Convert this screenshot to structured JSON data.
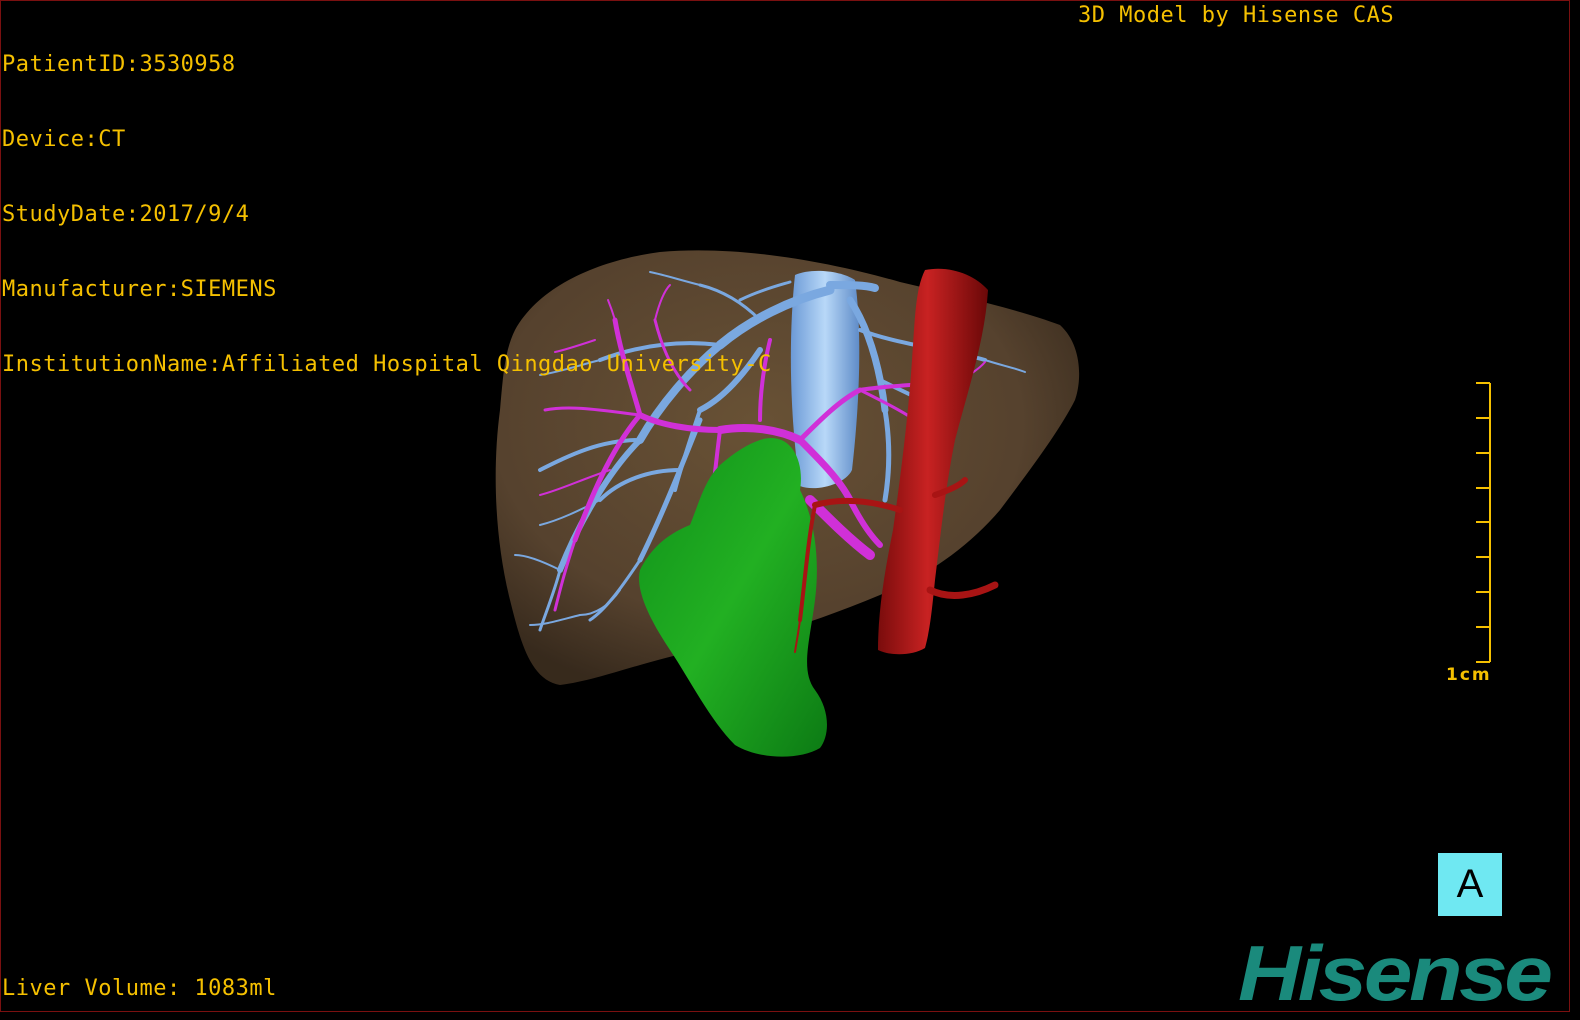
{
  "dicom_info": {
    "patient_id": "PatientID:3530958",
    "device": "Device:CT",
    "study_date": "StudyDate:2017/9/4",
    "manufacturer": "Manufacturer:SIEMENS",
    "institution": "InstitutionName:Affiliated Hospital Qingdao University-C"
  },
  "title": "3D Model by Hisense CAS",
  "liver_volume": "Liver Volume: 1083ml",
  "scale_bar": {
    "label": "1cm"
  },
  "orientation_label": "A",
  "logo_text": "Hisense",
  "colors": {
    "overlay_text": "#f5c000",
    "liver": "#8a6a42",
    "portal_vein": "#7aa8e0",
    "hepatic_vein": "#d030d8",
    "ivc_artery": "#b01818",
    "stomach": "#18a018",
    "orientation_box": "#6fe8f2",
    "logo": "#1a8a7c"
  }
}
